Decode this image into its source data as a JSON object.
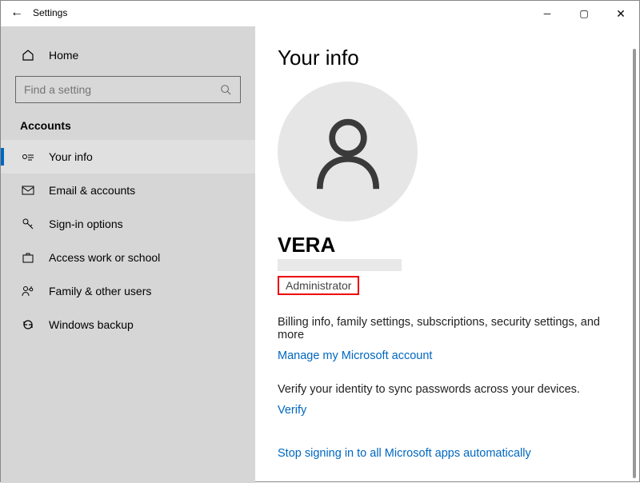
{
  "window": {
    "title": "Settings"
  },
  "sidebar": {
    "home_label": "Home",
    "search_placeholder": "Find a setting",
    "section_title": "Accounts",
    "items": [
      {
        "label": "Your info"
      },
      {
        "label": "Email & accounts"
      },
      {
        "label": "Sign-in options"
      },
      {
        "label": "Access work or school"
      },
      {
        "label": "Family & other users"
      },
      {
        "label": "Windows backup"
      }
    ]
  },
  "main": {
    "heading": "Your info",
    "user_name": "VERA",
    "role": "Administrator",
    "billing_text": "Billing info, family settings, subscriptions, security settings, and more",
    "manage_link": "Manage my Microsoft account",
    "verify_text": "Verify your identity to sync passwords across your devices.",
    "verify_link": "Verify",
    "stop_signin_link": "Stop signing in to all Microsoft apps automatically"
  }
}
